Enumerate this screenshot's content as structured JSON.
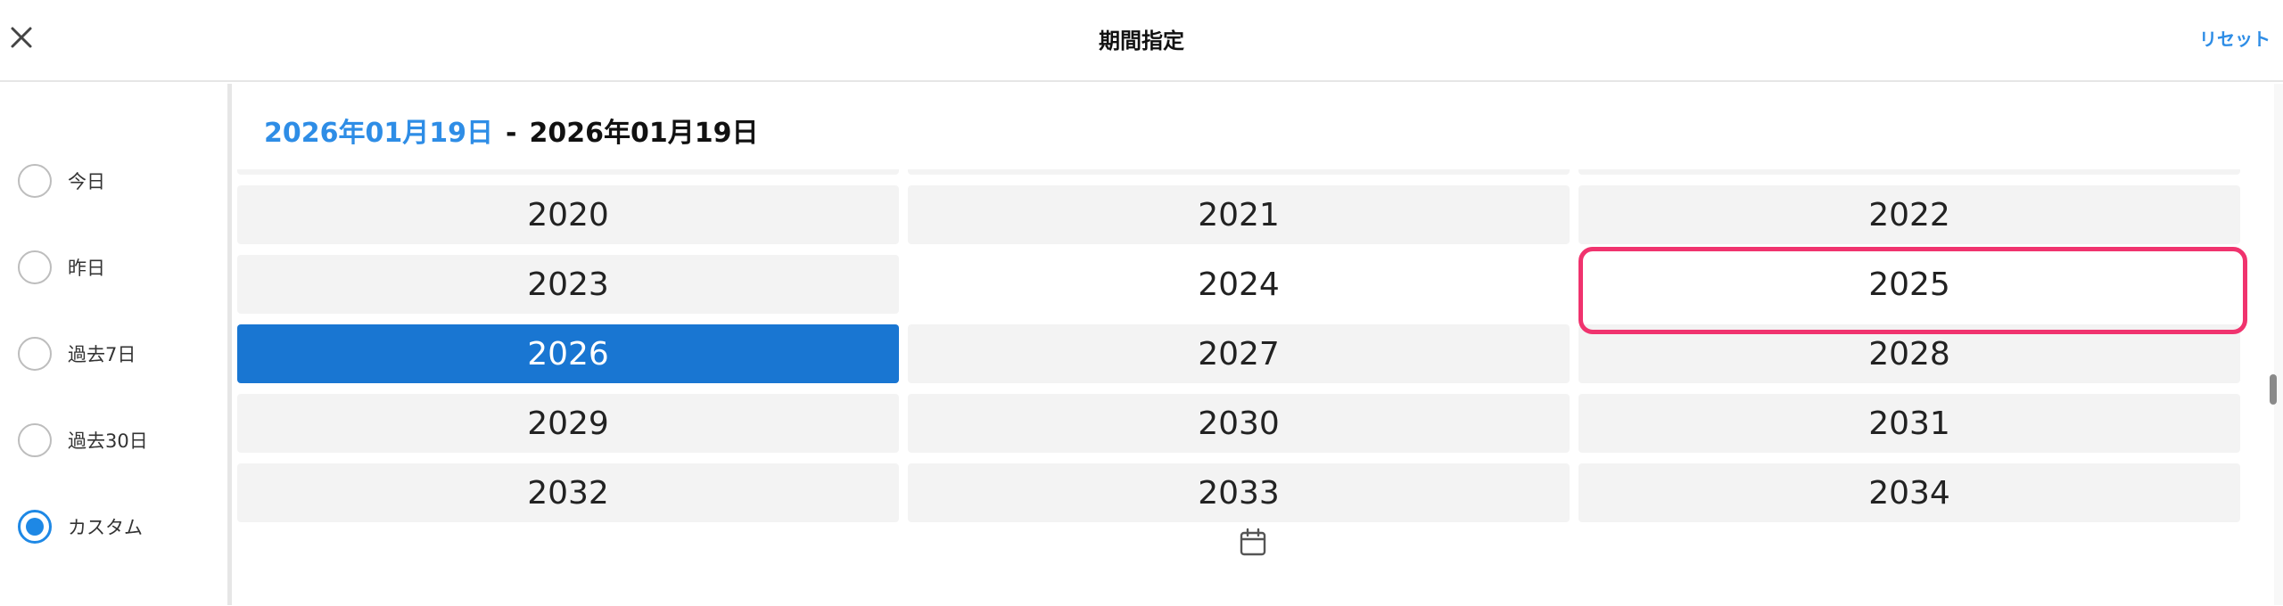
{
  "header": {
    "title": "期間指定",
    "reset_label": "リセット"
  },
  "sidebar": {
    "options": [
      {
        "label": "今日",
        "checked": false
      },
      {
        "label": "昨日",
        "checked": false
      },
      {
        "label": "過去7日",
        "checked": false
      },
      {
        "label": "過去30日",
        "checked": false
      },
      {
        "label": "カスタム",
        "checked": true
      }
    ]
  },
  "range": {
    "start": "2026年01月19日",
    "separator": "-",
    "end": "2026年01月19日"
  },
  "years": [
    "2020",
    "2021",
    "2022",
    "2023",
    "2024",
    "2025",
    "2026",
    "2027",
    "2028",
    "2029",
    "2030",
    "2031",
    "2032",
    "2033",
    "2034"
  ],
  "selected_year": "2026",
  "current_year": "2024",
  "highlighted_year": "2025",
  "colors": {
    "accent": "#1976d2",
    "link": "#2e8de6",
    "highlight": "#f0336e"
  },
  "icons": {
    "close": "close-icon",
    "calendar": "calendar-icon"
  }
}
